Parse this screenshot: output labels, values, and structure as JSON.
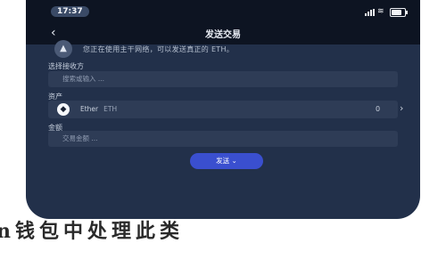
{
  "status": {
    "time": "17:37"
  },
  "header": {
    "back_icon": "chevron-left-icon",
    "title": "发送交易"
  },
  "notice": {
    "icon": "warning-triangle-icon",
    "text": "您正在使用主干网络，可以发送真正的 ETH。"
  },
  "form": {
    "network_label": "选择接收方",
    "network_placeholder": "搜索或输入 ...",
    "asset_label": "资产",
    "asset_name": "Ether",
    "asset_symbol": "ETH",
    "asset_balance": "0",
    "amount_label": "金额",
    "amount_placeholder": "交易金额 ..."
  },
  "send_button": {
    "label": "发送"
  },
  "caption": "n钱包中处理此类"
}
